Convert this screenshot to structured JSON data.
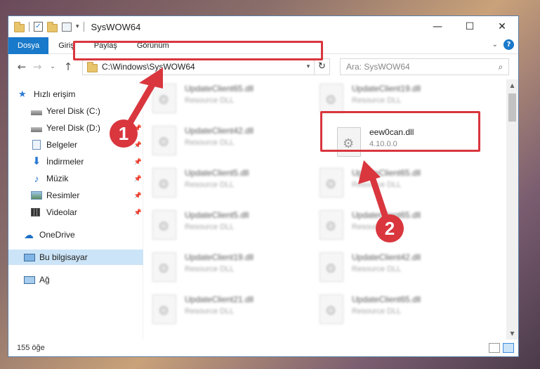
{
  "window": {
    "title": "SysWOW64",
    "controls": {
      "minimize": "—",
      "maximize": "☐",
      "close": "✕"
    }
  },
  "ribbon": {
    "tabs": [
      "Dosya",
      "Giriş",
      "Paylaş",
      "Görünüm"
    ],
    "help": "?"
  },
  "addressbar": {
    "path": "C:\\Windows\\SysWOW64",
    "search_placeholder": "Ara: SysWOW64"
  },
  "sidebar": {
    "items": [
      {
        "label": "Hızlı erişim",
        "icon": "star-icon"
      },
      {
        "label": "Yerel Disk (C:)",
        "icon": "drive-icon",
        "pinned": true
      },
      {
        "label": "Yerel Disk (D:)",
        "icon": "drive-icon",
        "pinned": true
      },
      {
        "label": "Belgeler",
        "icon": "documents-icon",
        "pinned": true
      },
      {
        "label": "İndirmeler",
        "icon": "download-icon",
        "pinned": true
      },
      {
        "label": "Müzik",
        "icon": "music-icon",
        "pinned": true
      },
      {
        "label": "Resimler",
        "icon": "pictures-icon",
        "pinned": true
      },
      {
        "label": "Videolar",
        "icon": "videos-icon",
        "pinned": true
      },
      {
        "label": "OneDrive",
        "icon": "cloud-icon"
      },
      {
        "label": "Bu bilgisayar",
        "icon": "computer-icon",
        "selected": true
      },
      {
        "label": "Ağ",
        "icon": "network-icon"
      }
    ]
  },
  "files": {
    "left": [
      {
        "name": "UpdateClient65.dll",
        "desc": "Resource DLL"
      },
      {
        "name": "UpdateClient42.dll",
        "desc": "Resource DLL"
      },
      {
        "name": "UpdateClient5.dll",
        "desc": "Resource DLL"
      },
      {
        "name": "UpdateClient5.dll",
        "desc": "Resource DLL"
      },
      {
        "name": "UpdateClient19.dll",
        "desc": "Resource DLL"
      },
      {
        "name": "UpdateClient21.dll",
        "desc": "Resource DLL"
      }
    ],
    "right": [
      {
        "name": "UpdateClient19.dll",
        "desc": "Resource DLL"
      },
      {
        "name": "eew0can.dll",
        "desc": "4.10.0.0",
        "highlight": true
      },
      {
        "name": "UpdateClient65.dll",
        "desc": "Resource DLL"
      },
      {
        "name": "UpdateClient65.dll",
        "desc": "Resource DLL"
      },
      {
        "name": "UpdateClient42.dll",
        "desc": "Resource DLL"
      },
      {
        "name": "UpdateClient65.dll",
        "desc": "Resource DLL"
      }
    ]
  },
  "status": {
    "count": "155 öğe"
  },
  "annotations": {
    "badge1": "1",
    "badge2": "2",
    "color": "#d9363e"
  }
}
